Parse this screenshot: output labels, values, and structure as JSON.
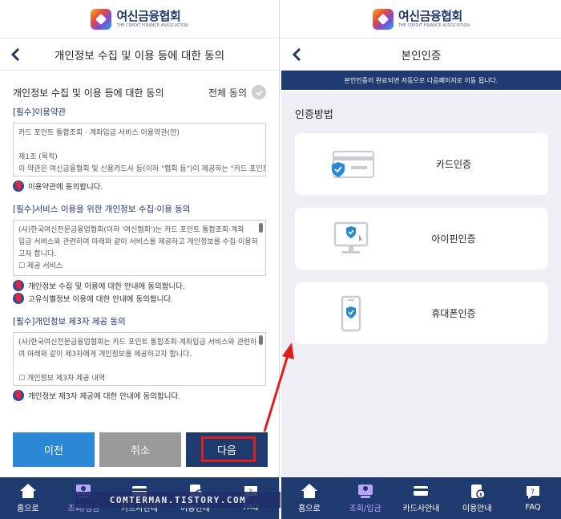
{
  "logo": {
    "name_ko": "여신금융협회",
    "name_en": "THE CREDIT FINANCE ASSOCIATION"
  },
  "left": {
    "header_title": "개인정보 수집 및 이용 등에 대한 동의",
    "section_title": "개인정보 수집 및 이용 등에 대한 동의",
    "agree_all": "전체 동의",
    "terms": [
      {
        "title": "[필수]이용약관",
        "lines": [
          "카드 포인트 통합조회 · 계좌입금 서비스 이용약관(안)",
          "",
          "제1조 (목적)",
          "이 약관은 여신금융협회 및 신용카드사 등(이하 \"협회 등\")이 제공하는 \"카드 포인트"
        ],
        "agrees": [
          "이용약관에 동의합니다."
        ]
      },
      {
        "title": "[필수]서비스 이용을 위한 개인정보 수집·이용 동의",
        "lines": [
          "(사)한국여신전문금융업협회(이하 '여신협회')는 카드 포인트 통합조회·계좌",
          "입금 서비스와 관련하여 아래와 같이 서비스를 제공하고 개인정보를 수집·이용하",
          "고자 합니다.",
          "☐ 제공 서비스"
        ],
        "agrees": [
          "개인정보 수집 및 이용에 대한 안내에 동의합니다.",
          "고유식별정보 이용에 대한 안내에 동의합니다."
        ]
      },
      {
        "title": "[필수]개인정보 제3자 제공 동의",
        "lines": [
          "(사)한국여신전문금융업협회는 카드 포인트 통합조회·계좌입금 서비스와 관련하",
          "여 아래와 같이 제3자에게 개인정보를 제공하고자 합니다.",
          "",
          "☐ 개인정보 제3자 제공 내역"
        ],
        "agrees": [
          "개인정보 제3자 제공에 대한 안내에 동의합니다."
        ]
      }
    ],
    "buttons": {
      "prev": "이전",
      "cancel": "취소",
      "next": "다음"
    }
  },
  "right": {
    "header_title": "본인인증",
    "notice": "본인인증이 완료되면 자동으로 다음페이지로 이동 됩니다.",
    "method_title": "인증방법",
    "methods": [
      "카드인증",
      "아이핀인증",
      "휴대폰인증"
    ]
  },
  "tabbar": {
    "items": [
      "홈으로",
      "조회/입금",
      "카드사안내",
      "이용안내",
      "FAQ"
    ],
    "active": "조회/입금"
  },
  "watermark": "COMTERMAN.TISTORY.COM",
  "colors": {
    "navy": "#1f3a6e",
    "blue": "#2a88d4",
    "gray": "#9a9a9a",
    "highlight": "#e21d1d",
    "active_tab": "#b9a4ff"
  }
}
